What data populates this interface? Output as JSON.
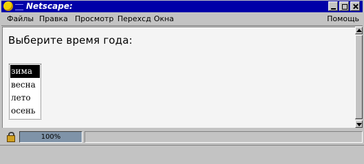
{
  "window": {
    "title": "Netscape:"
  },
  "menubar": {
    "items": [
      "Файлы",
      "Правка",
      "Просмотр",
      "Перехсд",
      "Окна"
    ],
    "help": "Помощь"
  },
  "page": {
    "heading": "Выберите время года:",
    "listbox": {
      "options": [
        "зима",
        "весна",
        "лето",
        "осень"
      ],
      "selected": "зима"
    }
  },
  "statusbar": {
    "progress_text": "100%",
    "progress": 1.0,
    "status_text": ""
  },
  "colors": {
    "titlebar": "#0000a8",
    "chrome": "#c3c3c3",
    "content_bg": "#f4f4f4",
    "selection": "#000000",
    "progress": "#7f93a8"
  },
  "icons": {
    "window_menu": "netscape-sun-icon",
    "close": "close-icon",
    "maximize": "maximize-icon",
    "iconify": "minimize-icon",
    "security": "lock-icon"
  }
}
